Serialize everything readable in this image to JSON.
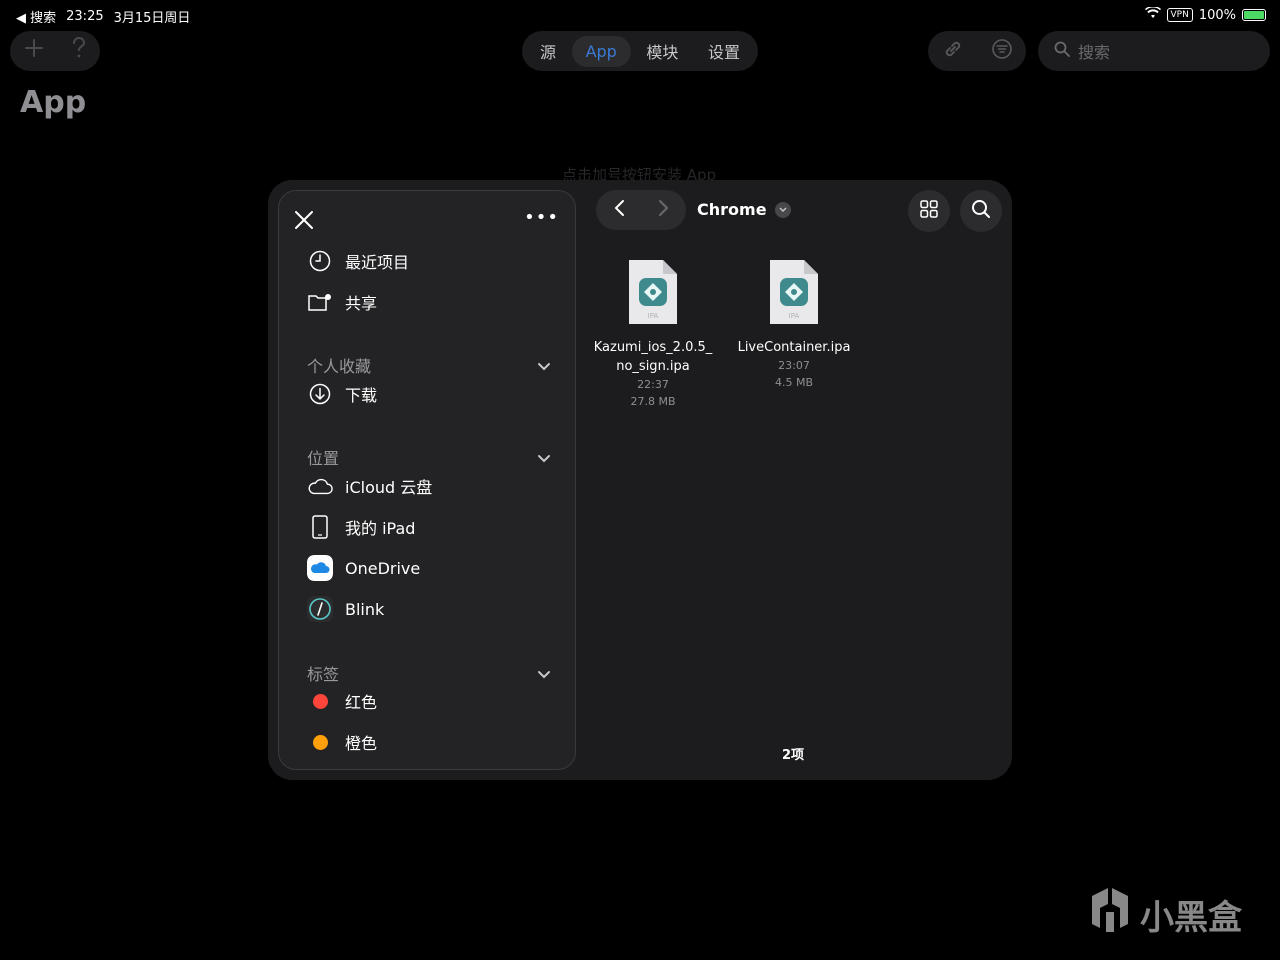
{
  "status": {
    "back_label": "◀ 搜索",
    "time": "23:25",
    "date": "3月15日周日",
    "vpn": "VPN",
    "battery": "100%"
  },
  "toolbar": {
    "add_icon": "plus-icon",
    "help_icon": "question-icon",
    "tabs": [
      {
        "label": "源",
        "active": false
      },
      {
        "label": "App",
        "active": true
      },
      {
        "label": "模块",
        "active": false
      },
      {
        "label": "设置",
        "active": false
      }
    ],
    "search_placeholder": "搜索"
  },
  "page": {
    "title": "App",
    "hint": "点击加号按钮安装 App"
  },
  "picker": {
    "folder_name": "Chrome",
    "sidebar": {
      "top_items": [
        {
          "label": "最近项目",
          "icon": "clock-icon"
        },
        {
          "label": "共享",
          "icon": "shared-folder-icon"
        }
      ],
      "favorites": {
        "title": "个人收藏",
        "items": [
          {
            "label": "下载",
            "icon": "download-icon"
          }
        ]
      },
      "locations": {
        "title": "位置",
        "items": [
          {
            "label": "iCloud 云盘",
            "icon": "cloud-icon"
          },
          {
            "label": "我的 iPad",
            "icon": "ipad-icon"
          },
          {
            "label": "OneDrive",
            "icon": "onedrive-icon"
          },
          {
            "label": "Blink",
            "icon": "blink-icon"
          }
        ]
      },
      "tags": {
        "title": "标签",
        "items": [
          {
            "label": "红色",
            "color": "#ff453a"
          },
          {
            "label": "橙色",
            "color": "#ff9f0a"
          }
        ]
      }
    },
    "files": [
      {
        "name_line1": "Kazumi_ios_2.0.5_",
        "name_line2": "no_sign.ipa",
        "time": "22:37",
        "size": "27.8 MB",
        "badge": "IPA"
      },
      {
        "name_line1": "LiveContainer.ipa",
        "name_line2": "",
        "time": "23:07",
        "size": "4.5 MB",
        "badge": "IPA"
      }
    ],
    "item_count": "2项"
  },
  "watermark": "小黑盒"
}
